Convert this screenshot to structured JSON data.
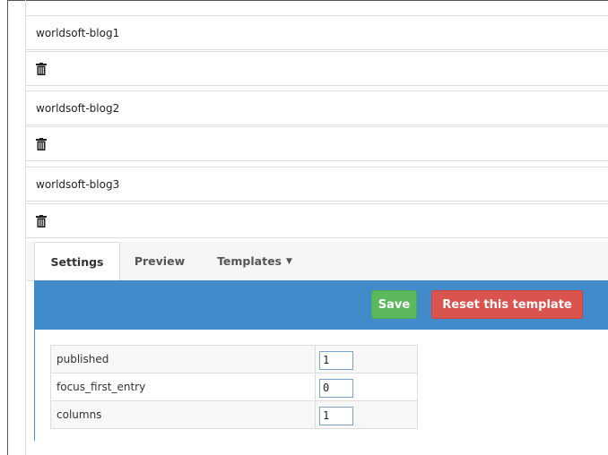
{
  "entries": [
    {
      "title": "worldsoft-blog1",
      "delete_icon": "trash-icon"
    },
    {
      "title": "worldsoft-blog2",
      "delete_icon": "trash-icon"
    },
    {
      "title": "worldsoft-blog3",
      "delete_icon": "trash-icon"
    }
  ],
  "tabs": [
    {
      "label": "Settings",
      "active": true
    },
    {
      "label": "Preview",
      "active": false
    },
    {
      "label": "Templates",
      "active": false,
      "dropdown_icon": "caret-down-icon"
    }
  ],
  "toolbar": {
    "save_label": "Save",
    "reset_label": "Reset this template",
    "background_color": "#428bca",
    "save_color": "#5cb85c",
    "reset_color": "#d9534f"
  },
  "settings": [
    {
      "key": "published",
      "value": "1"
    },
    {
      "key": "focus_first_entry",
      "value": "0"
    },
    {
      "key": "columns",
      "value": "1"
    }
  ]
}
